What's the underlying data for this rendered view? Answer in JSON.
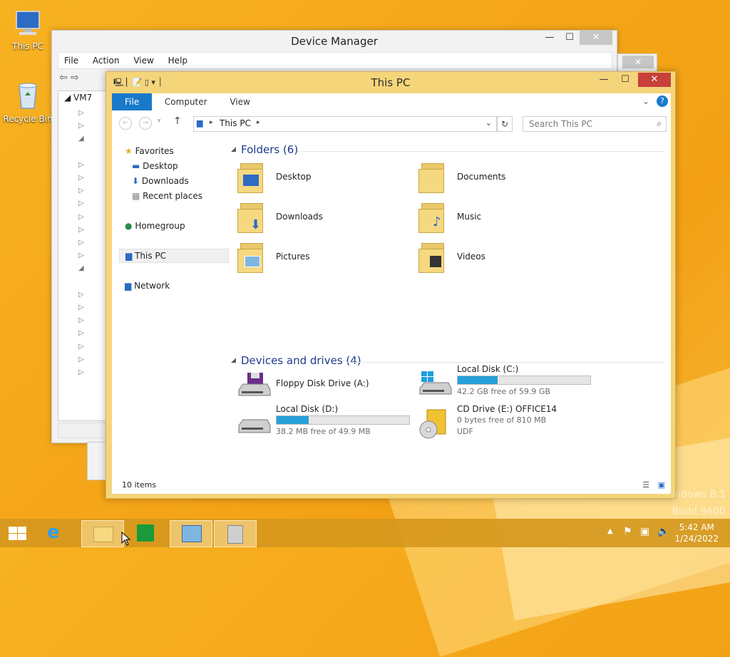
{
  "desktop": {
    "icons": [
      {
        "label": "This PC"
      },
      {
        "label": "Recycle Bin"
      }
    ],
    "watermark": {
      "line1": "Windows 8.1",
      "line2": "Build 9600"
    }
  },
  "device_manager": {
    "title": "Device Manager",
    "menu": [
      "File",
      "Action",
      "View",
      "Help"
    ],
    "tree_root": "VM7"
  },
  "explorer": {
    "title": "This PC",
    "ribbon_tabs": [
      "File",
      "Computer",
      "View"
    ],
    "address": {
      "path": "This PC"
    },
    "search": {
      "placeholder": "Search This PC"
    },
    "nav": {
      "favorites": "Favorites",
      "desktop": "Desktop",
      "downloads": "Downloads",
      "recent": "Recent places",
      "homegroup": "Homegroup",
      "thispc": "This PC",
      "network": "Network"
    },
    "folders_header": "Folders (6)",
    "folders": [
      "Desktop",
      "Documents",
      "Downloads",
      "Music",
      "Pictures",
      "Videos"
    ],
    "drives_header": "Devices and drives (4)",
    "drives": [
      {
        "name": "Floppy Disk Drive (A:)",
        "free": "",
        "fill": 0
      },
      {
        "name": "Local Disk (C:)",
        "free": "42.2 GB free of 59.9 GB",
        "fill": 0.3
      },
      {
        "name": "Local Disk (D:)",
        "free": "38.2 MB free of 49.9 MB",
        "fill": 0.24
      },
      {
        "name": "CD Drive (E:) OFFICE14",
        "free": "0 bytes free of 810 MB",
        "extra": "UDF",
        "fill": 1
      }
    ],
    "status": "10 items"
  },
  "taskbar": {
    "time": "5:42 AM",
    "date": "1/24/2022"
  }
}
